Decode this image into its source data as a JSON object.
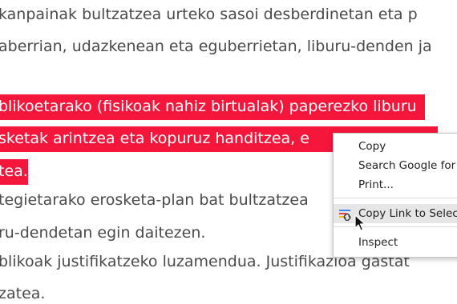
{
  "document": {
    "lines": [
      "kanpainak bultzatzea urteko sasoi desberdinetan eta p",
      "aberrian, udazkenean eta eguberrietan, liburu-denden ja",
      "blikoetarako (fisikoak nahiz birtualak) paperezko liburu",
      "sketak arintzea eta kopuruz handitzea, e",
      "tea.",
      "tegietarako erosketa-plan bat bultzatzea",
      "ru-dendetan egin daitezen.",
      "blikoak justifikatzeko luzamendua. Justifikazioa gastat",
      "zatea."
    ]
  },
  "colors": {
    "selection_background": "#f5173b",
    "selection_text": "#ffffff",
    "body_text": "#4a4a4a",
    "menu_hover": "#e6e6e6"
  },
  "context_menu": {
    "items": [
      {
        "label": "Copy"
      },
      {
        "label": "Search Google for"
      },
      {
        "label": "Print..."
      },
      {
        "label": "Copy Link to Selec",
        "icon": "link-highlight-icon",
        "hovered": true
      },
      {
        "label": "Inspect"
      }
    ]
  }
}
